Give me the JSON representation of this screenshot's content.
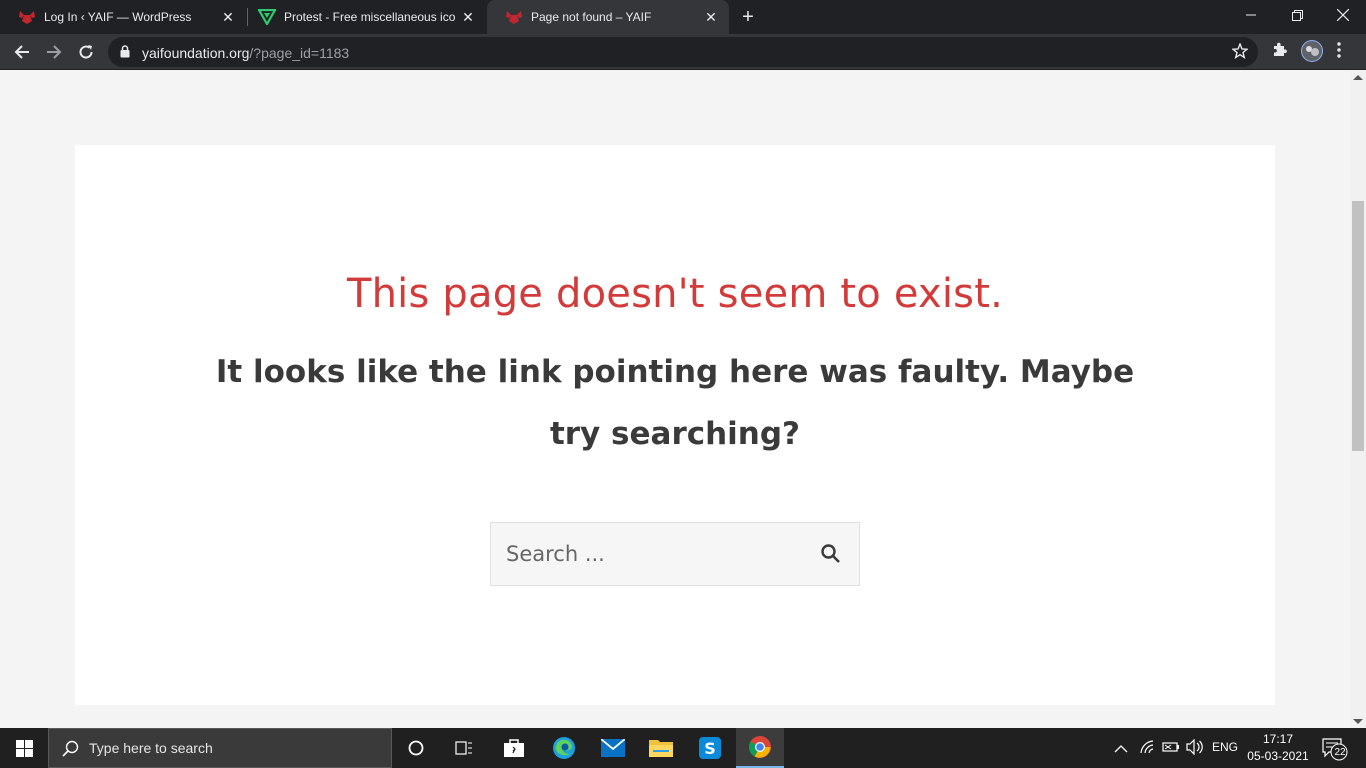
{
  "browser": {
    "tabs": [
      {
        "title": "Log In ‹ YAIF — WordPress",
        "favicon": "yaif-logo-icon",
        "active": false
      },
      {
        "title": "Protest - Free miscellaneous icon",
        "favicon": "green-v-icon",
        "active": false
      },
      {
        "title": "Page not found – YAIF",
        "favicon": "yaif-logo-icon",
        "active": true
      }
    ],
    "url_host": "yaifoundation.org",
    "url_path": "/?page_id=1183"
  },
  "page": {
    "title": "This page doesn't seem to exist.",
    "subtitle": "It looks like the link pointing here was faulty. Maybe try searching?",
    "search_placeholder": "Search ...",
    "colors": {
      "title": "#d33a3a",
      "text": "#3a3a3a",
      "background": "#f4f4f4",
      "card": "#ffffff"
    }
  },
  "taskbar": {
    "search_placeholder": "Type here to search",
    "language": "ENG",
    "time": "17:17",
    "date": "05-03-2021",
    "notification_count": "22",
    "pinned": [
      "cortana-icon",
      "task-view-icon",
      "store-icon",
      "edge-icon",
      "mail-icon",
      "file-explorer-icon",
      "skype-icon",
      "chrome-icon"
    ]
  }
}
